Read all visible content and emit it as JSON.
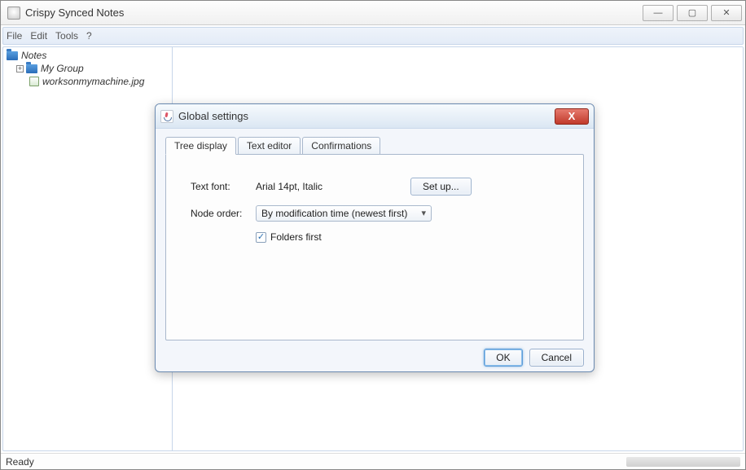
{
  "window": {
    "title": "Crispy Synced Notes"
  },
  "menu": {
    "file": "File",
    "edit": "Edit",
    "tools": "Tools",
    "help": "?"
  },
  "tree": {
    "root": "Notes",
    "group": "My Group",
    "file": "worksonmymachine.jpg"
  },
  "status": {
    "text": "Ready"
  },
  "dialog": {
    "title": "Global settings",
    "tabs": {
      "tree_display": "Tree display",
      "text_editor": "Text editor",
      "confirmations": "Confirmations"
    },
    "form": {
      "text_font_label": "Text font:",
      "text_font_value": "Arial 14pt, Italic",
      "setup_button": "Set up...",
      "node_order_label": "Node order:",
      "node_order_value": "By modification time (newest first)",
      "folders_first_label": "Folders first",
      "folders_first_checked": true
    },
    "buttons": {
      "ok": "OK",
      "cancel": "Cancel"
    }
  }
}
